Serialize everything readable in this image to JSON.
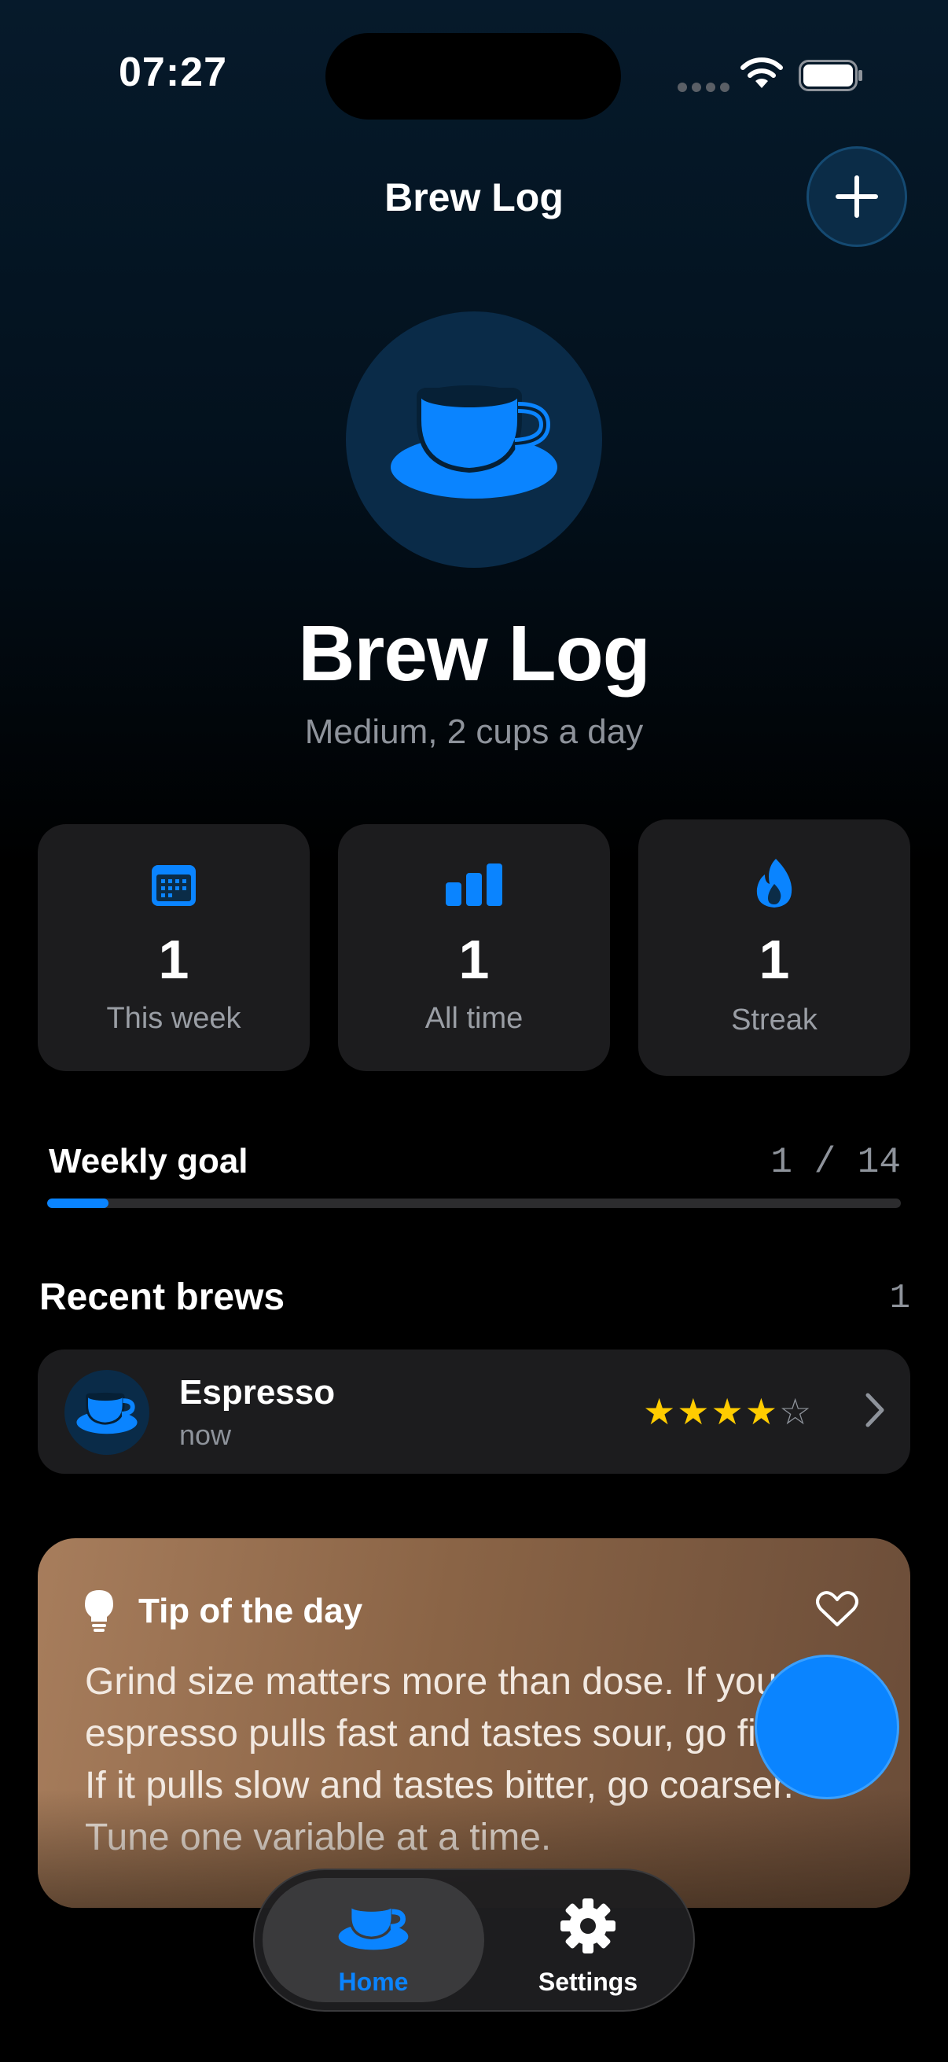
{
  "status_bar": {
    "time": "07:27"
  },
  "nav": {
    "title": "Brew Log",
    "add_icon": "plus-icon"
  },
  "hero": {
    "icon": "coffee-cup-icon",
    "title": "Brew Log",
    "subtitle": "Medium, 2 cups a day"
  },
  "stats": [
    {
      "icon": "calendar-icon",
      "value": "1",
      "label": "This week"
    },
    {
      "icon": "bar-chart-icon",
      "value": "1",
      "label": "All time"
    },
    {
      "icon": "flame-icon",
      "value": "1",
      "label": "Streak"
    }
  ],
  "weekly_goal": {
    "label": "Weekly goal",
    "current": 1,
    "target": 14,
    "count_text": "1 / 14"
  },
  "recent": {
    "label": "Recent brews",
    "count": "1",
    "items": [
      {
        "name": "Espresso",
        "time": "now",
        "rating": 4,
        "max_rating": 5
      }
    ]
  },
  "tip": {
    "title": "Tip of the day",
    "body": "Grind size matters more than dose. If your espresso pulls fast and tastes sour, go finer. If it pulls slow and tastes bitter, go coarser. Tune one variable at a time."
  },
  "tabs": [
    {
      "label": "Home",
      "icon": "coffee-cup-icon",
      "active": true
    },
    {
      "label": "Settings",
      "icon": "gear-icon",
      "active": false
    }
  ],
  "colors": {
    "accent": "#0a84ff",
    "star": "#ffcc00",
    "card": "#1c1c1e"
  }
}
